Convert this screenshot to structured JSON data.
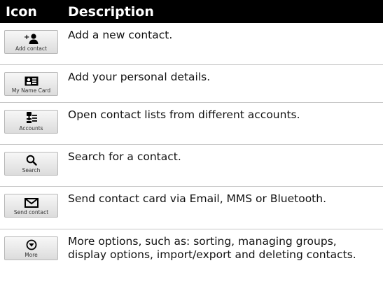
{
  "header": {
    "icon_col": "Icon",
    "desc_col": "Description"
  },
  "rows": [
    {
      "icon": "add-contact-icon",
      "caption": "Add contact",
      "description": "Add a new contact."
    },
    {
      "icon": "name-card-icon",
      "caption": "My Name Card",
      "description": "Add your personal details."
    },
    {
      "icon": "accounts-icon",
      "caption": "Accounts",
      "description": "Open contact lists from different accounts."
    },
    {
      "icon": "search-icon",
      "caption": "Search",
      "description": "Search for a contact."
    },
    {
      "icon": "envelope-icon",
      "caption": "Send contact",
      "description": "Send contact card via Email, MMS or Bluetooth."
    },
    {
      "icon": "more-icon",
      "caption": "More",
      "description": "More options, such as: sorting, managing groups, display options, import/export and deleting contacts."
    }
  ]
}
